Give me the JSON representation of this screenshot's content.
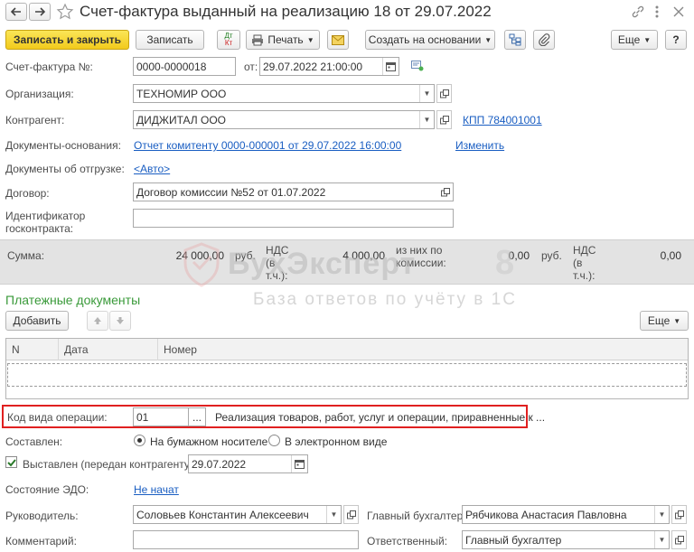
{
  "window": {
    "title": "Счет-фактура выданный на реализацию 18 от 29.07.2022"
  },
  "toolbar": {
    "save_close": "Записать и закрыть",
    "save": "Записать",
    "dtkt_top": "Дт",
    "dtkt_bottom": "Кт",
    "print": "Печать",
    "create_based": "Создать на основании",
    "more": "Еще",
    "help": "?"
  },
  "form": {
    "invoice_label": "Счет-фактура №:",
    "invoice_number": "0000-0000018",
    "from_label": "от:",
    "invoice_date": "29.07.2022 21:00:00",
    "org_label": "Организация:",
    "org_value": "ТЕХНОМИР ООО",
    "contractor_label": "Контрагент:",
    "contractor_value": "ДИДЖИТАЛ ООО",
    "kpp_link": "КПП 784001001",
    "base_docs_label": "Документы-основания:",
    "base_docs_link": "Отчет комитенту 0000-000001 от 29.07.2022 16:00:00",
    "change_link": "Изменить",
    "shipping_label": "Документы об отгрузке:",
    "shipping_link": "<Авто>",
    "contract_label": "Договор:",
    "contract_value": "Договор комиссии №52 от 01.07.2022",
    "gov_id_label_1": "Идентификатор",
    "gov_id_label_2": "госконтракта:",
    "gov_id_value": ""
  },
  "summary": {
    "sum_label": "Сумма:",
    "sum_value": "24 000,00",
    "currency": "руб.",
    "vat_label_1": "НДС",
    "vat_label_2": "(в",
    "vat_label_3": "т.ч.):",
    "vat_value": "4 000,00",
    "commission_label_1": "из них по",
    "commission_label_2": "комиссии:",
    "commission_value": "0,00",
    "currency2": "руб.",
    "vat2_label_1": "НДС",
    "vat2_label_2": "(в",
    "vat2_label_3": "т.ч.):",
    "vat2_value": "0,00"
  },
  "watermark": {
    "brand": "БухЭксперт",
    "digit": "8",
    "tagline": "База ответов по учёту в 1С"
  },
  "payments": {
    "title": "Платежные документы",
    "add": "Добавить",
    "more": "Еще",
    "columns": [
      "N",
      "Дата",
      "Номер"
    ]
  },
  "operation": {
    "label": "Код вида операции:",
    "code": "01",
    "dots": "...",
    "description": "Реализация товаров, работ, услуг и операции, приравненные к ..."
  },
  "composed": {
    "label": "Составлен:",
    "paper": "На бумажном носителе",
    "electronic": "В электронном виде"
  },
  "issued": {
    "label": "Выставлен (передан контрагенту):",
    "date": "29.07.2022"
  },
  "edo": {
    "label": "Состояние ЭДО:",
    "link": "Не начат"
  },
  "people": {
    "head_label": "Руководитель:",
    "head_value": "Соловьев Константин Алексеевич",
    "accountant_label": "Главный бухгалтер:",
    "accountant_value": "Рябчикова Анастасия Павловна",
    "comment_label": "Комментарий:",
    "comment_value": "",
    "responsible_label": "Ответственный:",
    "responsible_value": "Главный бухгалтер"
  },
  "colors": {
    "primary_button": "#f2ca1c",
    "link": "#1a5ec2",
    "section_title": "#3a9a3a",
    "highlight_border": "#e02020",
    "summary_bg": "#e3e3e3"
  }
}
